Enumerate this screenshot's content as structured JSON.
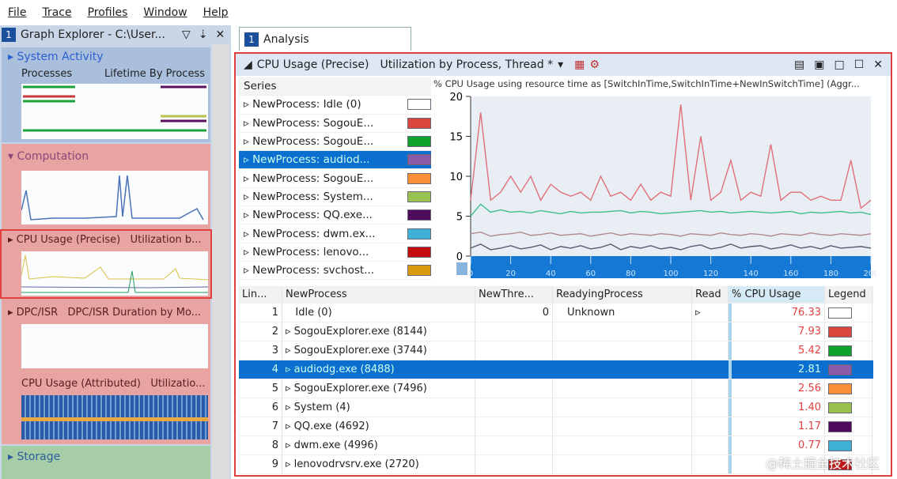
{
  "menu": [
    "File",
    "Trace",
    "Profiles",
    "Window",
    "Help"
  ],
  "left": {
    "title": "Graph Explorer - C:\\User...",
    "num": "1",
    "sections": [
      {
        "name": "System Activity",
        "sub1": "Processes",
        "sub2": "Lifetime By Process"
      },
      {
        "name": "Computation"
      },
      {
        "name": "CPU Usage (Precise)",
        "sub2": "Utilization b..."
      },
      {
        "name": "DPC/ISR",
        "sub2": "DPC/ISR Duration by Mo..."
      },
      {
        "name": "CPU Usage (Attributed)",
        "sub2": "Utilizatio..."
      },
      {
        "name": "Storage"
      }
    ]
  },
  "tab": {
    "num": "1",
    "label": "Analysis"
  },
  "panel": {
    "graph": "CPU Usage (Precise)",
    "preset": "Utilization by Process, Thread *",
    "series_header": "Series"
  },
  "series": [
    {
      "label": "NewProcess: Idle (0)",
      "color": "#ffffff"
    },
    {
      "label": "NewProcess: SogouE...",
      "color": "#d9463e"
    },
    {
      "label": "NewProcess: SogouE...",
      "color": "#0ea12c"
    },
    {
      "label": "NewProcess: audiod...",
      "color": "#8a5aa8"
    },
    {
      "label": "NewProcess: SogouE...",
      "color": "#fb9039"
    },
    {
      "label": "NewProcess: System...",
      "color": "#9bc24e"
    },
    {
      "label": "NewProcess: QQ.exe...",
      "color": "#4f0a5e"
    },
    {
      "label": "NewProcess: dwm.ex...",
      "color": "#3fb1d6"
    },
    {
      "label": "NewProcess: lenovo...",
      "color": "#c50d0d"
    },
    {
      "label": "NewProcess: svchost...",
      "color": "#da9a10"
    }
  ],
  "chart_data": {
    "type": "line",
    "title": "% CPU Usage using resource time as [SwitchInTime,SwitchInTime+NewInSwitchTime] (Aggr...",
    "ylim": [
      0,
      20
    ],
    "xlim": [
      0,
      200
    ],
    "yticks": [
      "0",
      "5",
      "10",
      "15",
      "20"
    ],
    "xticks": [
      "0",
      "20",
      "40",
      "60",
      "80",
      "100",
      "120",
      "140",
      "160",
      "180",
      "200"
    ],
    "x": [
      0,
      5,
      10,
      15,
      20,
      25,
      30,
      35,
      40,
      45,
      50,
      55,
      60,
      65,
      70,
      75,
      80,
      85,
      90,
      95,
      100,
      105,
      110,
      115,
      120,
      125,
      130,
      135,
      140,
      145,
      150,
      155,
      160,
      165,
      170,
      175,
      180,
      185,
      190,
      195,
      200
    ],
    "series": [
      {
        "color": "#e0707a",
        "values": [
          7,
          18,
          7,
          8,
          10,
          8,
          10,
          7,
          9,
          8,
          7.5,
          8,
          7,
          10,
          7.5,
          8,
          7,
          9,
          7,
          8,
          7.5,
          19,
          7,
          15,
          7,
          8,
          12,
          7,
          8,
          7.5,
          14,
          7,
          8,
          8,
          7,
          7.5,
          7,
          7,
          12,
          6,
          7
        ]
      },
      {
        "color": "#3fc08a",
        "values": [
          5,
          6.5,
          5.5,
          5.8,
          5.5,
          5.6,
          5.4,
          5.7,
          5.5,
          5.3,
          5.6,
          5.4,
          5.5,
          5.5,
          5.6,
          5.7,
          5.4,
          5.6,
          5.5,
          5.3,
          5.4,
          5.5,
          5.6,
          5.7,
          5.5,
          5.6,
          5.4,
          5.5,
          5.6,
          5.5,
          5.4,
          5.5,
          5.6,
          5.3,
          5.5,
          5.4,
          5.5,
          5.6,
          5.4,
          5.5,
          5.2
        ]
      },
      {
        "color": "#b08a90",
        "values": [
          2.8,
          3,
          2.5,
          2.7,
          2.8,
          3,
          2.6,
          2.7,
          2.9,
          2.6,
          2.7,
          2.8,
          2.5,
          2.7,
          2.9,
          2.6,
          2.8,
          2.7,
          2.6,
          2.8,
          2.7,
          2.5,
          2.8,
          2.7,
          2.6,
          2.9,
          2.7,
          2.6,
          2.8,
          2.7,
          2.5,
          2.8,
          2.7,
          2.6,
          2.9,
          2.7,
          2.6,
          2.8,
          2.7,
          2.6,
          2.8
        ]
      },
      {
        "color": "#555a70",
        "values": [
          1,
          1.5,
          0.8,
          1,
          1.3,
          0.9,
          1.1,
          1.4,
          0.8,
          1.2,
          1,
          1.3,
          0.9,
          1.1,
          1.5,
          0.8,
          1.2,
          1,
          1.3,
          0.9,
          1.1,
          0.8,
          1.2,
          1.4,
          0.9,
          1.1,
          1.5,
          1,
          1.2,
          1.3,
          0.9,
          1.1,
          1.4,
          1,
          1.2,
          0.9,
          1.3,
          1,
          1.1,
          1.2,
          1
        ]
      }
    ]
  },
  "table": {
    "headers": [
      "Lin...",
      "NewProcess",
      "NewThre...",
      "ReadyingProcess",
      "Read",
      "% CPU Usage",
      "Legend"
    ],
    "rows": [
      {
        "n": "1",
        "p": "Idle (0)",
        "t": "0",
        "r": "Unknown",
        "cpu": "76.33",
        "color": "#ffffff"
      },
      {
        "n": "2",
        "p": "SogouExplorer.exe (8144)",
        "t": "",
        "r": "",
        "cpu": "7.93",
        "color": "#d9463e"
      },
      {
        "n": "3",
        "p": "SogouExplorer.exe (3744)",
        "t": "",
        "r": "",
        "cpu": "5.42",
        "color": "#0ea12c"
      },
      {
        "n": "4",
        "p": "audiodg.exe (8488)",
        "t": "",
        "r": "",
        "cpu": "2.81",
        "color": "#8a5aa8"
      },
      {
        "n": "5",
        "p": "SogouExplorer.exe (7496)",
        "t": "",
        "r": "",
        "cpu": "2.56",
        "color": "#fb9039"
      },
      {
        "n": "6",
        "p": "System (4)",
        "t": "",
        "r": "",
        "cpu": "1.40",
        "color": "#9bc24e"
      },
      {
        "n": "7",
        "p": "QQ.exe (4692)",
        "t": "",
        "r": "",
        "cpu": "1.17",
        "color": "#4f0a5e"
      },
      {
        "n": "8",
        "p": "dwm.exe (4996)",
        "t": "",
        "r": "",
        "cpu": "0.77",
        "color": "#3fb1d6"
      },
      {
        "n": "9",
        "p": "lenovodrvsrv.exe (2720)",
        "t": "",
        "r": "",
        "cpu": "",
        "color": "#c50d0d"
      }
    ]
  },
  "watermark": "@稀土掘金技术社区"
}
